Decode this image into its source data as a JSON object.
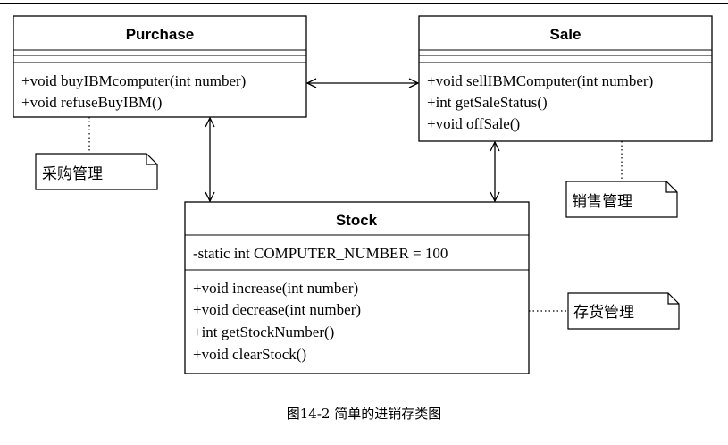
{
  "classes": {
    "purchase": {
      "name": "Purchase",
      "methods": [
        "+void buyIBMcomputer(int number)",
        "+void refuseBuyIBM()"
      ]
    },
    "sale": {
      "name": "Sale",
      "methods": [
        "+void sellIBMComputer(int number)",
        "+int getSaleStatus()",
        "+void offSale()"
      ]
    },
    "stock": {
      "name": "Stock",
      "attributes": [
        "-static int COMPUTER_NUMBER = 100"
      ],
      "methods": [
        "+void increase(int number)",
        "+void decrease(int number)",
        "+int getStockNumber()",
        "+void clearStock()"
      ]
    }
  },
  "notes": {
    "purchase": "采购管理",
    "sale": "销售管理",
    "stock": "存货管理"
  },
  "caption": "图14-2 简单的进销存类图"
}
